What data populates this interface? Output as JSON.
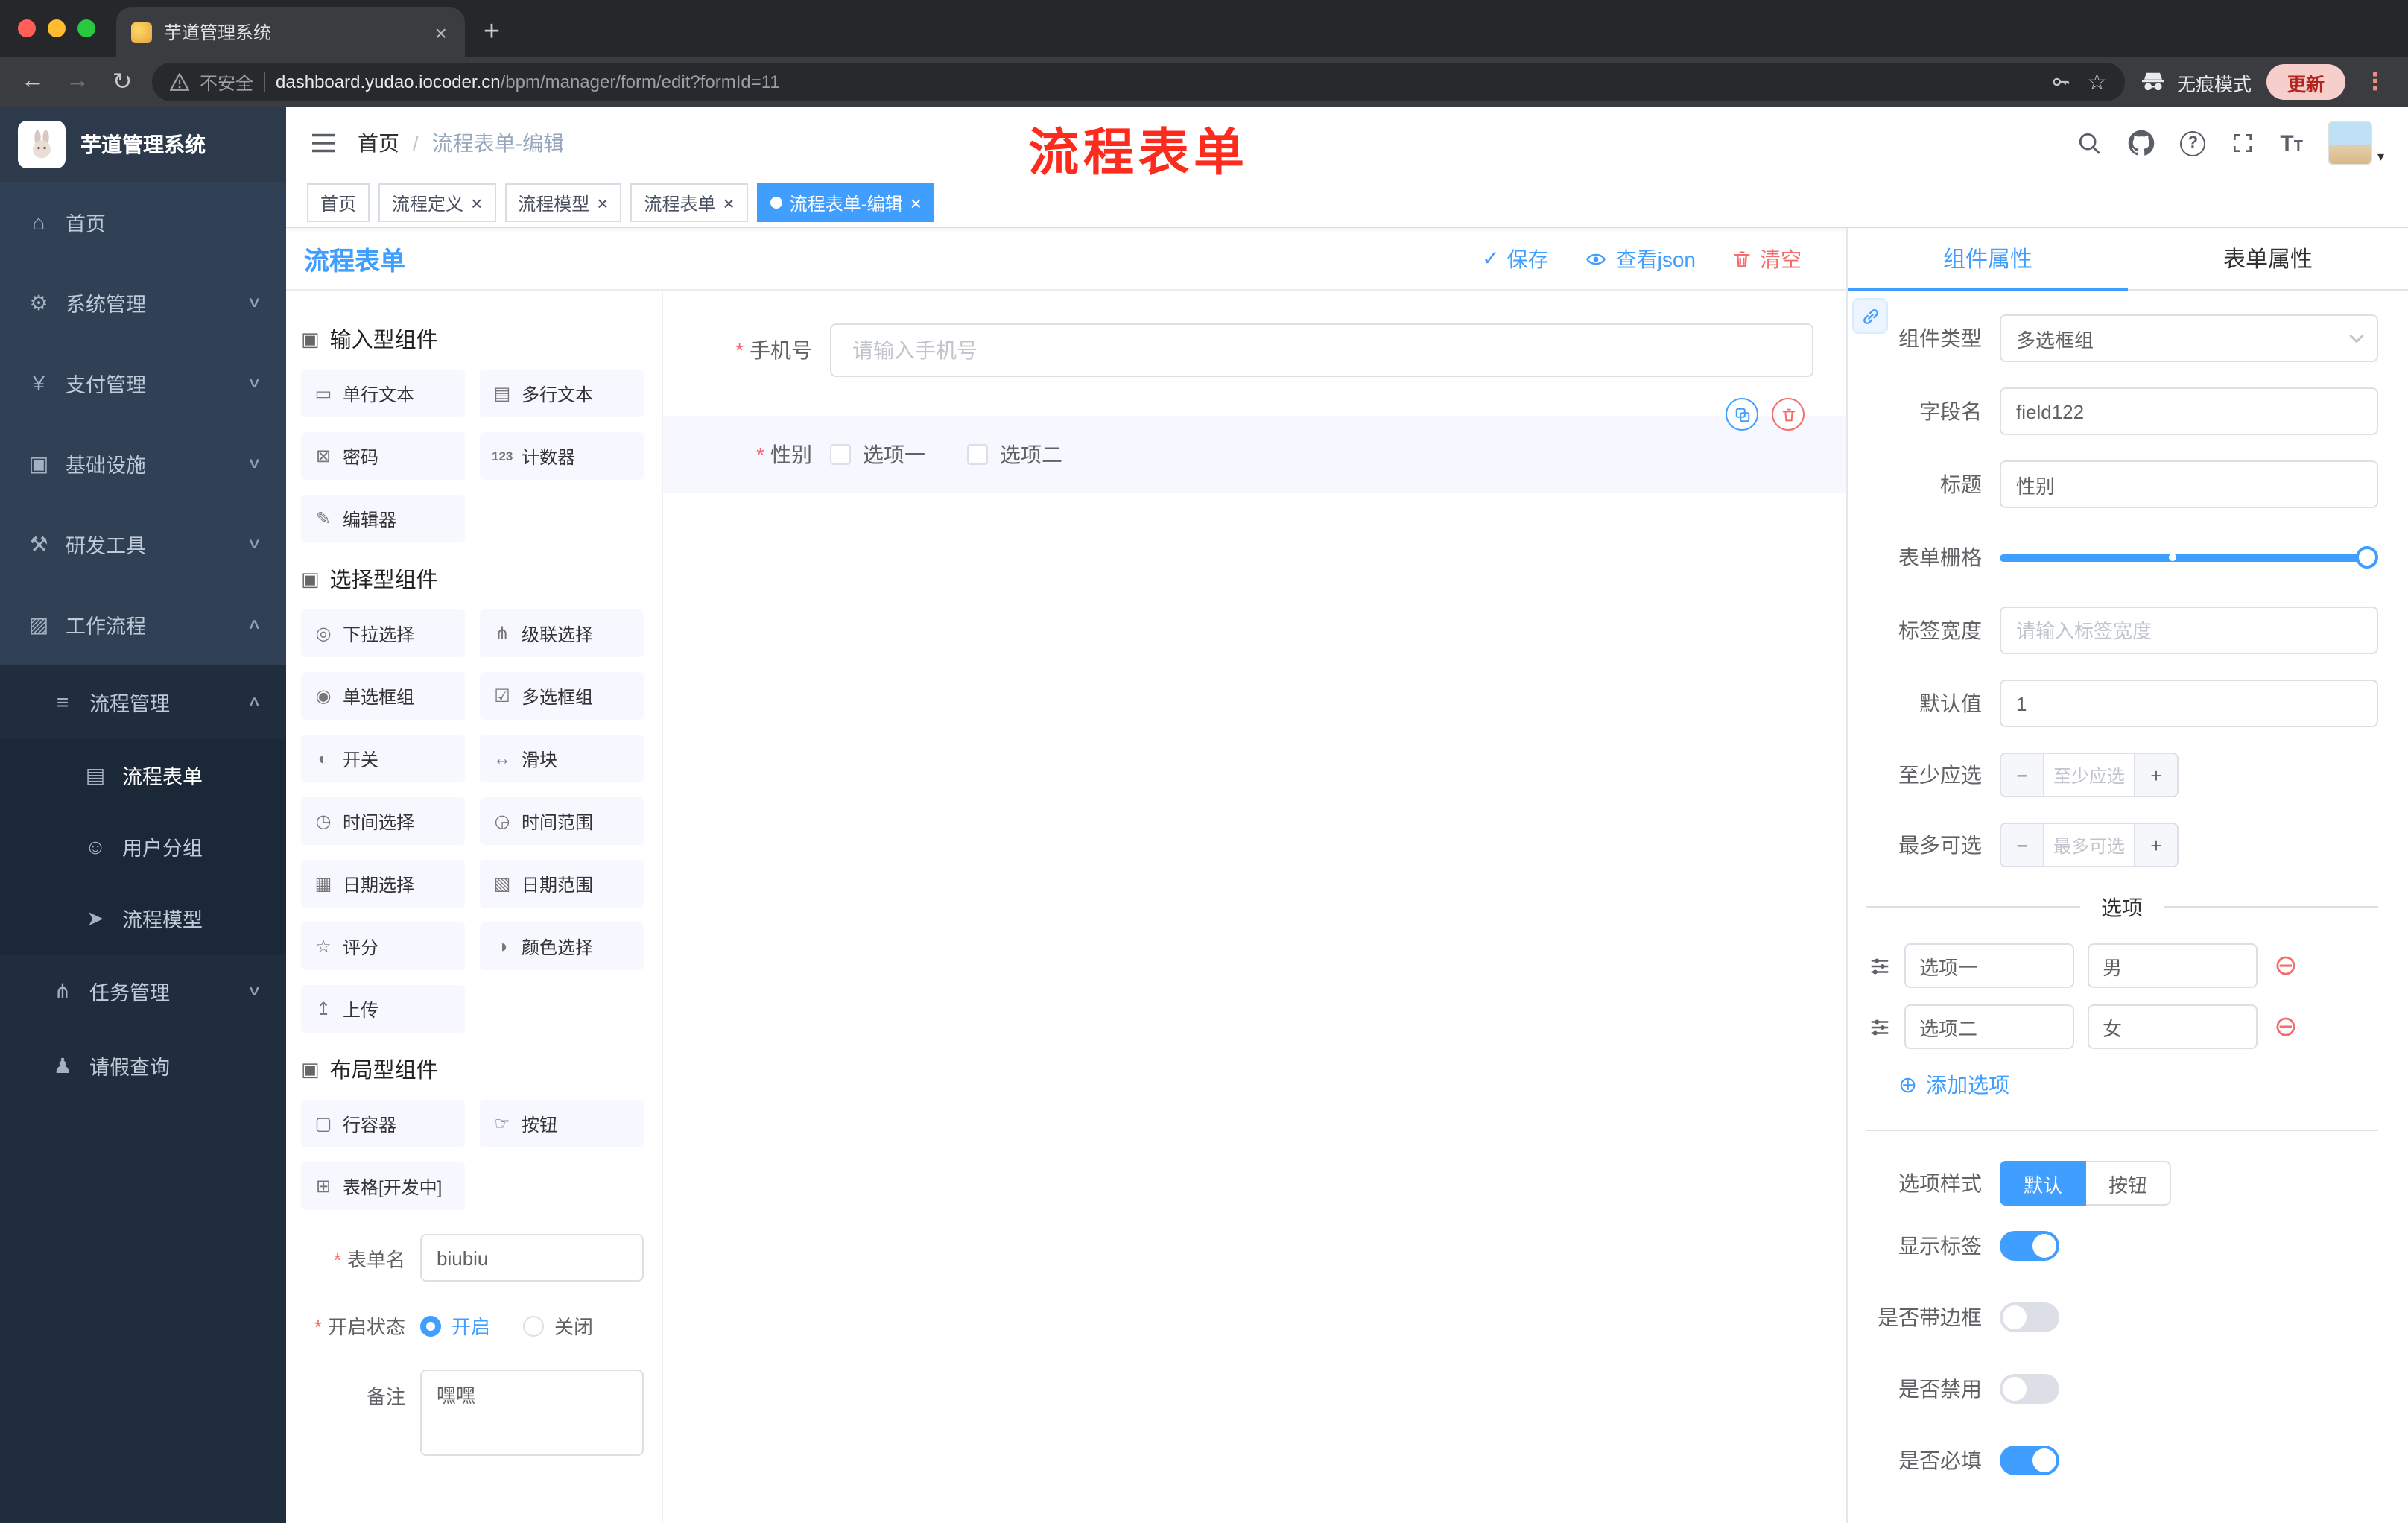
{
  "colors": {
    "primary": "#409eff",
    "danger": "#f56c6c",
    "sidebar": "#304156",
    "annotation": "#fd2b1e"
  },
  "browser": {
    "tab_title": "芋道管理系统",
    "security_label": "不安全",
    "url_host": "dashboard.yudao.iocoder.cn",
    "url_path": "/bpm/manager/form/edit?formId=11",
    "incognito_label": "无痕模式",
    "update_label": "更新"
  },
  "sidebar": {
    "brand": "芋道管理系统",
    "items": [
      {
        "label": "首页",
        "icon": "⌂"
      },
      {
        "label": "系统管理",
        "icon": "⚙",
        "chevron": "∨"
      },
      {
        "label": "支付管理",
        "icon": "¥",
        "chevron": "∨"
      },
      {
        "label": "基础设施",
        "icon": "▣",
        "chevron": "∨"
      },
      {
        "label": "研发工具",
        "icon": "⚒",
        "chevron": "∨"
      },
      {
        "label": "工作流程",
        "icon": "▨",
        "chevron": "∧"
      },
      {
        "label": "流程管理",
        "icon": "≡",
        "chevron": "∧"
      },
      {
        "label": "流程表单",
        "icon": "▤"
      },
      {
        "label": "用户分组",
        "icon": "☺"
      },
      {
        "label": "流程模型",
        "icon": "➤"
      },
      {
        "label": "任务管理",
        "icon": "⋔",
        "chevron": "∨"
      },
      {
        "label": "请假查询",
        "icon": "♟"
      }
    ]
  },
  "navbar": {
    "breadcrumb": [
      "首页",
      "流程表单-编辑"
    ],
    "annotation": "流程表单"
  },
  "tags": [
    {
      "label": "首页"
    },
    {
      "label": "流程定义"
    },
    {
      "label": "流程模型"
    },
    {
      "label": "流程表单"
    },
    {
      "label": "流程表单-编辑"
    }
  ],
  "designer": {
    "title": "流程表单",
    "actions": {
      "save": "保存",
      "view_json": "查看json",
      "clear": "清空"
    },
    "palette": {
      "sections": [
        {
          "title": "输入型组件",
          "icon": "▣",
          "items": [
            {
              "label": "单行文本",
              "icon": "▭"
            },
            {
              "label": "多行文本",
              "icon": "▤"
            },
            {
              "label": "密码",
              "icon": "⊠"
            },
            {
              "label": "计数器",
              "icon": "123"
            },
            {
              "label": "编辑器",
              "icon": "✎"
            }
          ]
        },
        {
          "title": "选择型组件",
          "icon": "▣",
          "items": [
            {
              "label": "下拉选择",
              "icon": "◎"
            },
            {
              "label": "级联选择",
              "icon": "⋔"
            },
            {
              "label": "单选框组",
              "icon": "◉"
            },
            {
              "label": "多选框组",
              "icon": "☑"
            },
            {
              "label": "开关",
              "icon": "◐"
            },
            {
              "label": "滑块",
              "icon": "↔"
            },
            {
              "label": "时间选择",
              "icon": "◷"
            },
            {
              "label": "时间范围",
              "icon": "◶"
            },
            {
              "label": "日期选择",
              "icon": "▦"
            },
            {
              "label": "日期范围",
              "icon": "▧"
            },
            {
              "label": "评分",
              "icon": "☆"
            },
            {
              "label": "颜色选择",
              "icon": "◑"
            },
            {
              "label": "上传",
              "icon": "↥"
            }
          ]
        },
        {
          "title": "布局型组件",
          "icon": "▣",
          "items": [
            {
              "label": "行容器",
              "icon": "▢"
            },
            {
              "label": "按钮",
              "icon": "☞"
            },
            {
              "label": "表格[开发中]",
              "icon": "⊞"
            }
          ]
        }
      ]
    },
    "meta": {
      "name_label": "表单名",
      "name_value": "biubiu",
      "status_label": "开启状态",
      "status_on": "开启",
      "status_off": "关闭",
      "remark_label": "备注",
      "remark_value": "嘿嘿"
    },
    "canvas": {
      "phone": {
        "label": "手机号",
        "placeholder": "请输入手机号"
      },
      "gender": {
        "label": "性别",
        "options": [
          "选项一",
          "选项二"
        ]
      }
    }
  },
  "props": {
    "tab_component": "组件属性",
    "tab_form": "表单属性",
    "component_type_label": "组件类型",
    "component_type_value": "多选框组",
    "field_name_label": "字段名",
    "field_name_value": "field122",
    "title_label": "标题",
    "title_value": "性别",
    "grid_label": "表单栅格",
    "label_width_label": "标签宽度",
    "label_width_placeholder": "请输入标签宽度",
    "default_label": "默认值",
    "default_value": "1",
    "min_label": "至少应选",
    "min_placeholder": "至少应选",
    "max_label": "最多可选",
    "max_placeholder": "最多可选",
    "options_divider": "选项",
    "options": [
      {
        "label": "选项一",
        "value": "男"
      },
      {
        "label": "选项二",
        "value": "女"
      }
    ],
    "add_option": "添加选项",
    "style_label": "选项样式",
    "style_default": "默认",
    "style_button": "按钮",
    "switches": [
      {
        "label": "显示标签",
        "on": true
      },
      {
        "label": "是否带边框",
        "on": false
      },
      {
        "label": "是否禁用",
        "on": false
      },
      {
        "label": "是否必填",
        "on": true
      }
    ]
  }
}
